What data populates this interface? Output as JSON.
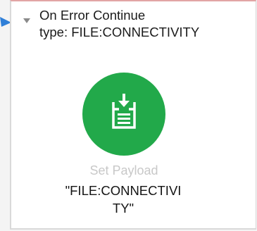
{
  "scope": {
    "title": "On Error Continue",
    "type_text": "type: FILE:CONNECTIVITY"
  },
  "component": {
    "icon": "set-payload-icon",
    "label": "Set Payload",
    "value_line1": "\"FILE:CONNECTIVI",
    "value_line2": "TY\""
  },
  "colors": {
    "component_green": "#22a94a",
    "scope_top_border": "#e2a5a5",
    "connector_blue": "#2f7fd8",
    "label_muted": "#c8c8c8"
  }
}
